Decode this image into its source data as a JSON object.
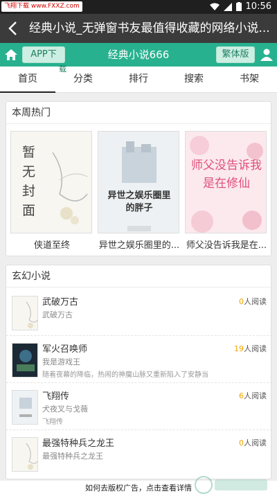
{
  "status": {
    "watermark": "飞翔下载 www.FXXZ.com",
    "time": "10:56"
  },
  "titlebar": {
    "title": "经典小说_无弹窗书友最值得收藏的网络小说..."
  },
  "greenbar": {
    "app_button": "APP下",
    "app_button_tail": "载",
    "site_name": "经典小说666",
    "trad_button": "繁体版"
  },
  "nav": {
    "tabs": [
      "首页",
      "分类",
      "排行",
      "搜索",
      "书架"
    ]
  },
  "hot": {
    "title": "本周热门",
    "books": [
      {
        "name": "侠道至终",
        "cover_text": "暂无封面"
      },
      {
        "name": "异世之娱乐圈里的...",
        "cover_text": "异世之娱乐圈里的胖子"
      },
      {
        "name": "师父没告诉我是在...",
        "cover_text": "师父没告诉我是在修仙"
      }
    ]
  },
  "fantasy": {
    "title": "玄幻小说",
    "reads_suffix": "人阅读",
    "items": [
      {
        "name": "武破万古",
        "author": "武破万古",
        "desc": "",
        "reads": "0"
      },
      {
        "name": "军火召唤师",
        "author": "我是游戏王",
        "desc": "随着夜幕的降临，热闹的神魔山脉又重新陷入了安静当",
        "reads": "19"
      },
      {
        "name": "飞翔传",
        "author": "犬夜叉与戈薇",
        "desc": "飞翔传",
        "reads": "6"
      },
      {
        "name": "最强特种兵之龙王",
        "author": "最强特种兵之龙王",
        "desc": "",
        "reads": "0"
      }
    ]
  },
  "footer": {
    "text": "如何去版权广告，点击查看详情"
  },
  "colors": {
    "accent": "#27b18f",
    "read_count": "#f0a400"
  }
}
